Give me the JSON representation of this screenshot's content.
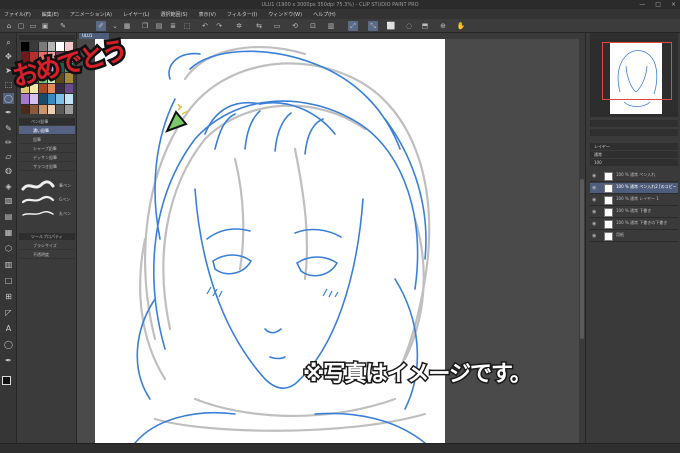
{
  "window": {
    "title": "ULU1 (1900 x 3000px 350dpi 75.3%) - CLIP STUDIO PAINT PRO",
    "controls": [
      "—",
      "□",
      "×"
    ]
  },
  "menu": [
    "ファイル(F)",
    "編集(E)",
    "アニメーション(A)",
    "レイヤー(L)",
    "選択範囲(S)",
    "表示(V)",
    "フィルター(I)",
    "ウィンドウ(W)",
    "ヘルプ(H)"
  ],
  "canvas": {
    "tab_label": "ULU1",
    "greeting_text": "おめでとう",
    "caption_text": "※写真はイメージです。"
  },
  "sub_tool": {
    "header": "ペン/鉛筆",
    "items": [
      "濃い鉛筆",
      "鉛筆",
      "シャープ鉛筆",
      "デッサン鉛筆",
      "ザラつき鉛筆"
    ],
    "selected_index": 0,
    "brushes": [
      "筆ペン",
      "Gペン",
      "丸ペン"
    ]
  },
  "tool_property": {
    "header": "ツールプロパティ",
    "rows": [
      "ブラシサイズ",
      "不透明度"
    ]
  },
  "layers": {
    "header": "レイヤー",
    "blend_mode": "通常",
    "opacity": "100",
    "items": [
      {
        "name": "100 % 通常\nペン入れ",
        "selected": false
      },
      {
        "name": "100 % 通常\nペン入れ2 [のコピー]",
        "selected": true
      },
      {
        "name": "100 % 通常\nレイヤー 1",
        "selected": false
      },
      {
        "name": "100 % 通常\n下書き",
        "selected": false
      },
      {
        "name": "100 % 通常\n下書きの下書き",
        "selected": false
      },
      {
        "name": "用紙",
        "selected": false
      }
    ]
  },
  "colors": {
    "accent": "#556283",
    "line_blue": "#3a7fd8",
    "sketch_gray": "#b4b4b4",
    "greeting_red": "#d81f2a"
  },
  "swatches": [
    "#000000",
    "#3a3a3a",
    "#7a7a7a",
    "#b5b5b5",
    "#ffffff",
    "#f4c9c9",
    "#6b1b1b",
    "#b43030",
    "#e86a6a",
    "#f2a3a3",
    "#7b3a5a",
    "#c16a8e",
    "#2b2b4a",
    "#3e3e7a",
    "#6c6cc4",
    "#a7a7ea",
    "#2a5a4a",
    "#4a9a7a",
    "#1d3a1d",
    "#3e7a3e",
    "#7ac27a",
    "#c7eac7",
    "#5a4a1a",
    "#a58a3a",
    "#e0c870",
    "#f6e7a8",
    "#a84a2a",
    "#e08a5a",
    "#3a2a4a",
    "#6a4a8a",
    "#a47ad0",
    "#d6c0f0",
    "#1a4a6a",
    "#3a8ac0",
    "#7ac0e8",
    "#c0e4f8",
    "#4a2a1a",
    "#8a5a3a",
    "#c8966a",
    "#ead0b4",
    "#5a5a5a",
    "#9a9a9a"
  ]
}
